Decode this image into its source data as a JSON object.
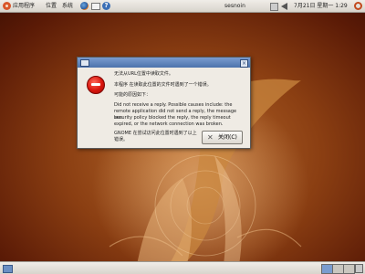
{
  "top_panel": {
    "menus": [
      "应用程序",
      "位置",
      "系统"
    ],
    "user": "sesnoin",
    "clock": "7月21日 星期一 1:29"
  },
  "dialog": {
    "title": "",
    "message_lines": [
      "无法从URL位置中读取文件。",
      "本程序 在读取此位置的文件时遇到了一个错误。",
      "可能的原因如下：",
      "Did not receive a reply. Possible causes include: the",
      "remote application did not send a reply, the message bus",
      "security policy blocked the reply, the reply timeout",
      "expired, or the network connection was broken.",
      "GNOME 在尝试访问此位置时遇到了以上错误。"
    ],
    "close_button": "关闭(C)"
  },
  "colors": {
    "accent": "#4d73ac",
    "error": "#d8140c",
    "panel": "#e4e1da"
  }
}
